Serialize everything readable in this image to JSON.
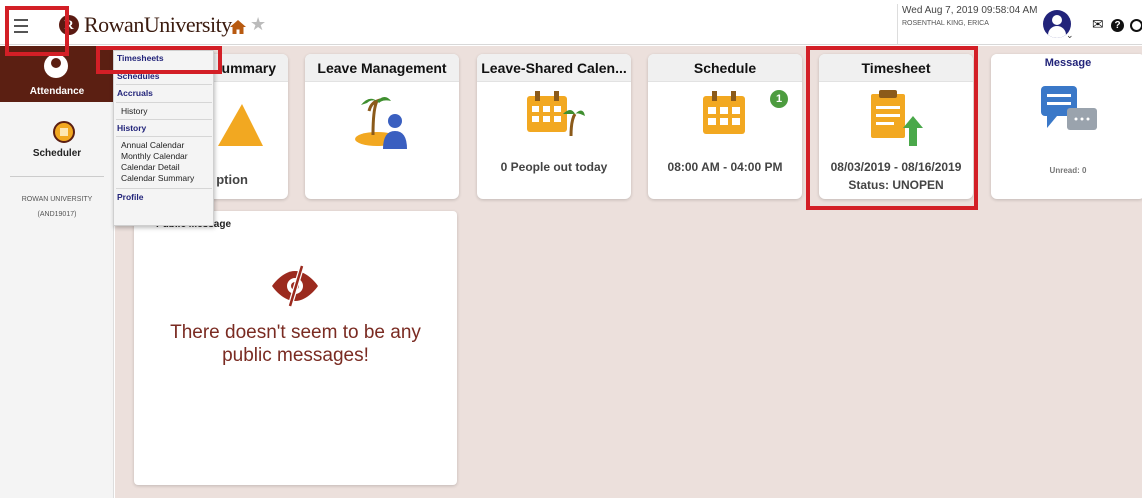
{
  "header": {
    "logo_text": "RowanUniversity",
    "logo_mark": "R",
    "datetime": "Wed Aug 7, 2019 09:58:04 AM",
    "user": "ROSENTHAL KING, ERICA",
    "icons": [
      "hamburger-icon",
      "home-icon",
      "star-icon",
      "avatar-icon",
      "mail-icon",
      "help-icon",
      "power-icon"
    ]
  },
  "rail": {
    "attendance_label": "Attendance",
    "scheduler_label": "Scheduler",
    "org_name": "ROWAN UNIVERSITY",
    "org_code": "(AND19017)"
  },
  "menu": {
    "items": [
      {
        "label": "Timesheets"
      },
      {
        "label": "Schedules"
      },
      {
        "label": "Accruals"
      },
      {
        "label": "History"
      },
      {
        "label": "History"
      },
      {
        "label": "Annual Calendar"
      },
      {
        "label": "Monthly Calendar"
      },
      {
        "label": "Calendar Detail"
      },
      {
        "label": "Calendar Summary"
      },
      {
        "label": "Profile"
      }
    ]
  },
  "tiles": [
    {
      "title": "ummary",
      "footer": "ption"
    },
    {
      "title": "Leave Management"
    },
    {
      "title": "Leave-Shared Calen...",
      "footer": "0 People out today"
    },
    {
      "title": "Schedule",
      "badge": "1",
      "footer": "08:00 AM - 04:00 PM"
    },
    {
      "title": "Timesheet",
      "footer": "08/03/2019 - 08/16/2019",
      "footer2": "Status: UNOPEN"
    },
    {
      "title": "Message",
      "footer": "Unread:  0"
    }
  ],
  "public_messages": {
    "title": "Public Message",
    "empty_text_line1": "There doesn't seem to be any",
    "empty_text_line2": "public messages!"
  },
  "colors": {
    "brand_maroon": "#5b1f12",
    "accent_gold": "#f2a821",
    "highlight_red": "#d31f26",
    "badge_green": "#4d9c3f",
    "navy": "#22247a",
    "message_blue": "#3a78c8",
    "upload_green": "#4aa84a",
    "palm_green": "#3f8f2f",
    "person_blue": "#3a5fc0"
  }
}
